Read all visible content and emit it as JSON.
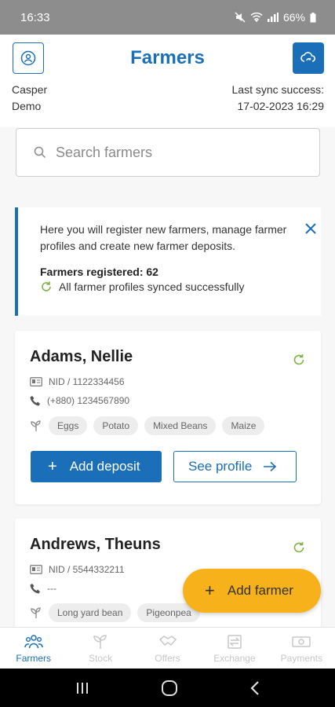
{
  "status_bar": {
    "time": "16:33",
    "battery": "66%"
  },
  "header": {
    "title": "Farmers",
    "user_line1": "Casper",
    "user_line2": "Demo",
    "sync_label": "Last sync success:",
    "sync_time": "17-02-2023 16:29"
  },
  "search": {
    "placeholder": "Search farmers"
  },
  "info": {
    "message": "Here you will register new farmers, manage farmer profiles and create new farmer deposits.",
    "registered": "Farmers registered: 62",
    "synced": "All farmer profiles synced successfully"
  },
  "farmers": [
    {
      "name": "Adams, Nellie",
      "nid": "NID / 1122334456",
      "phone": "(+880) 1234567890",
      "crops": [
        "Eggs",
        "Potato",
        "Mixed Beans",
        "Maize"
      ]
    },
    {
      "name": "Andrews, Theuns",
      "nid": "NID / 5544332211",
      "phone": "---",
      "crops": [
        "Long yard bean",
        "Pigeonpea"
      ]
    }
  ],
  "actions": {
    "add_deposit": "Add deposit",
    "see_profile": "See profile",
    "add_farmer": "Add farmer"
  },
  "nav": [
    "Farmers",
    "Stock",
    "Offers",
    "Exchange",
    "Payments"
  ],
  "colors": {
    "primary": "#1a6fb8",
    "accent": "#f7b21b",
    "sync_green": "#7cb342"
  }
}
